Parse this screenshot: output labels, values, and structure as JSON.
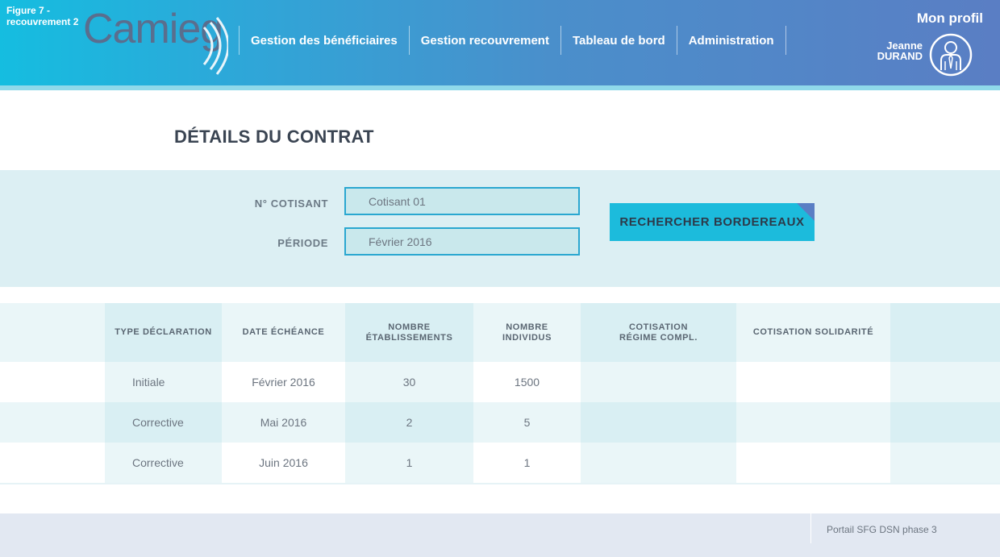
{
  "figure_label": "Figure 7 - recouvrement 2",
  "logo": {
    "text": "Camieg"
  },
  "nav": {
    "items": [
      {
        "label": "Gestion des bénéficiaires"
      },
      {
        "label": "Gestion recouvrement"
      },
      {
        "label": "Tableau de bord"
      },
      {
        "label": "Administration"
      }
    ]
  },
  "profile": {
    "title": "Mon profil",
    "first_name": "Jeanne",
    "last_name": "DURAND",
    "icon": "user-avatar-icon"
  },
  "page_title": "DÉTAILS DU CONTRAT",
  "search": {
    "cotisant_label": "N° COTISANT",
    "cotisant_value": "Cotisant 01",
    "periode_label": "PÉRIODE",
    "periode_value": "Février 2016",
    "button_label": "RECHERCHER BORDEREAUX"
  },
  "table": {
    "headers": [
      "",
      "TYPE DÉCLARATION",
      "DATE ÉCHÉANCE",
      "NOMBRE ÉTABLISSEMENTS",
      "NOMBRE INDIVIDUS",
      "COTISATION RÉGIME COMPL.",
      "COTISATION SOLIDARITÉ",
      ""
    ],
    "rows": [
      {
        "type": "Initiale",
        "date": "Février 2016",
        "etablissements": "30",
        "individus": "1500",
        "regime": "",
        "solidarite": ""
      },
      {
        "type": "Corrective",
        "date": "Mai 2016",
        "etablissements": "2",
        "individus": "5",
        "regime": "",
        "solidarite": ""
      },
      {
        "type": "Corrective",
        "date": "Juin 2016",
        "etablissements": "1",
        "individus": "1",
        "regime": "",
        "solidarite": ""
      }
    ]
  },
  "footer": {
    "text": "Portail SFG DSN phase 3"
  },
  "colors": {
    "header_start": "#15bde0",
    "header_end": "#5a7ec4",
    "accent": "#1cbbdc",
    "panel": "#dceff3"
  }
}
